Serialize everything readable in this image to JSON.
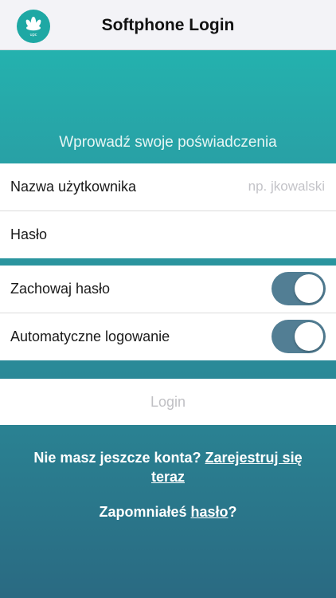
{
  "header": {
    "title": "Softphone Login",
    "logo_icon": "upc-logo",
    "logo_text": "upc"
  },
  "form": {
    "heading": "Wprowadź swoje poświadczenia",
    "username": {
      "label": "Nazwa użytkownika",
      "placeholder": "np. jkowalski",
      "value": ""
    },
    "password": {
      "label": "Hasło",
      "value": ""
    }
  },
  "options": {
    "remember_password": {
      "label": "Zachowaj hasło",
      "on": true
    },
    "auto_login": {
      "label": "Automatyczne logowanie",
      "on": true
    }
  },
  "login_button": {
    "label": "Login"
  },
  "register": {
    "prefix": "Nie masz jeszcze konta? ",
    "link_part1": "Zarejestruj się",
    "link_part2": "teraz"
  },
  "forgot": {
    "prefix": "Zapomniałeś ",
    "link": "hasło",
    "suffix": "?"
  },
  "colors": {
    "accent": "#22b9b2",
    "toggle_on": "#527e94",
    "header_bg": "#f3f3f7"
  }
}
